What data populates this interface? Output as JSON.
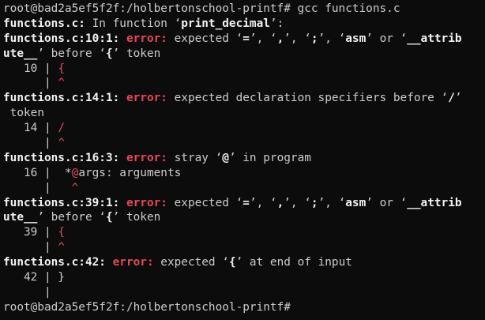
{
  "colors": {
    "background": "#0c0c0c",
    "text": "#cccccc",
    "bold_text": "#f2f2f2",
    "error_red": "#e74856"
  },
  "lines": [
    [
      {
        "t": "root@bad2a5ef5f2f:/holbertonschool-printf# gcc functions.c",
        "c": ""
      }
    ],
    [
      {
        "t": "functions.c:",
        "c": "b"
      },
      {
        "t": " In function ‘",
        "c": ""
      },
      {
        "t": "print_decimal",
        "c": "b"
      },
      {
        "t": "’:",
        "c": ""
      }
    ],
    [
      {
        "t": "functions.c:10:1:",
        "c": "b"
      },
      {
        "t": " ",
        "c": ""
      },
      {
        "t": "error:",
        "c": "err"
      },
      {
        "t": " expected ‘",
        "c": ""
      },
      {
        "t": "=",
        "c": "b"
      },
      {
        "t": "’, ‘",
        "c": ""
      },
      {
        "t": ",",
        "c": "b"
      },
      {
        "t": "’, ‘",
        "c": ""
      },
      {
        "t": ";",
        "c": "b"
      },
      {
        "t": "’, ‘",
        "c": ""
      },
      {
        "t": "asm",
        "c": "b"
      },
      {
        "t": "’ or ‘",
        "c": ""
      },
      {
        "t": "__attrib",
        "c": "b"
      }
    ],
    [
      {
        "t": "ute__",
        "c": "b"
      },
      {
        "t": "’ before ‘",
        "c": ""
      },
      {
        "t": "{",
        "c": "b"
      },
      {
        "t": "’ token",
        "c": ""
      }
    ],
    [
      {
        "t": "   10 | ",
        "c": ""
      },
      {
        "t": "{",
        "c": "red"
      }
    ],
    [
      {
        "t": "      | ",
        "c": ""
      },
      {
        "t": "^",
        "c": "red"
      }
    ],
    [
      {
        "t": "functions.c:14:1:",
        "c": "b"
      },
      {
        "t": " ",
        "c": ""
      },
      {
        "t": "error:",
        "c": "err"
      },
      {
        "t": " expected declaration specifiers before ‘",
        "c": ""
      },
      {
        "t": "/",
        "c": "b"
      },
      {
        "t": "’",
        "c": ""
      }
    ],
    [
      {
        "t": " token",
        "c": ""
      }
    ],
    [
      {
        "t": "   14 | ",
        "c": ""
      },
      {
        "t": "/",
        "c": "red"
      }
    ],
    [
      {
        "t": "      | ",
        "c": ""
      },
      {
        "t": "^",
        "c": "red"
      }
    ],
    [
      {
        "t": "functions.c:16:3:",
        "c": "b"
      },
      {
        "t": " ",
        "c": ""
      },
      {
        "t": "error:",
        "c": "err"
      },
      {
        "t": " stray ‘",
        "c": ""
      },
      {
        "t": "@",
        "c": "b"
      },
      {
        "t": "’ in program",
        "c": ""
      }
    ],
    [
      {
        "t": "   16 |  *",
        "c": ""
      },
      {
        "t": "@",
        "c": "red"
      },
      {
        "t": "args: arguments",
        "c": ""
      }
    ],
    [
      {
        "t": "      |   ",
        "c": ""
      },
      {
        "t": "^",
        "c": "red"
      }
    ],
    [
      {
        "t": "functions.c:39:1:",
        "c": "b"
      },
      {
        "t": " ",
        "c": ""
      },
      {
        "t": "error:",
        "c": "err"
      },
      {
        "t": " expected ‘",
        "c": ""
      },
      {
        "t": "=",
        "c": "b"
      },
      {
        "t": "’, ‘",
        "c": ""
      },
      {
        "t": ",",
        "c": "b"
      },
      {
        "t": "’, ‘",
        "c": ""
      },
      {
        "t": ";",
        "c": "b"
      },
      {
        "t": "’, ‘",
        "c": ""
      },
      {
        "t": "asm",
        "c": "b"
      },
      {
        "t": "’ or ‘",
        "c": ""
      },
      {
        "t": "__attrib",
        "c": "b"
      }
    ],
    [
      {
        "t": "ute__",
        "c": "b"
      },
      {
        "t": "’ before ‘",
        "c": ""
      },
      {
        "t": "{",
        "c": "b"
      },
      {
        "t": "’ token",
        "c": ""
      }
    ],
    [
      {
        "t": "   39 | ",
        "c": ""
      },
      {
        "t": "{",
        "c": "red"
      }
    ],
    [
      {
        "t": "      | ",
        "c": ""
      },
      {
        "t": "^",
        "c": "red"
      }
    ],
    [
      {
        "t": "functions.c:42:",
        "c": "b"
      },
      {
        "t": " ",
        "c": ""
      },
      {
        "t": "error:",
        "c": "err"
      },
      {
        "t": " expected ‘",
        "c": ""
      },
      {
        "t": "{",
        "c": "b"
      },
      {
        "t": "’ at end of input",
        "c": ""
      }
    ],
    [
      {
        "t": "   42 | }",
        "c": ""
      }
    ],
    [
      {
        "t": "      |",
        "c": ""
      }
    ],
    [
      {
        "t": "root@bad2a5ef5f2f:/holbertonschool-printf# ",
        "c": ""
      }
    ]
  ]
}
